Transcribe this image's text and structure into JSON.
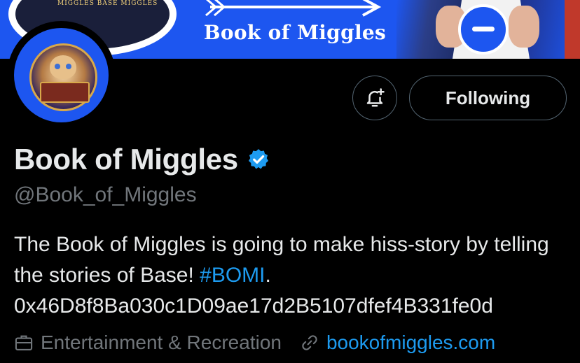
{
  "banner": {
    "title": "Book of Miggles",
    "book_text": "MIGGLES BASE MIGGLES",
    "colors": {
      "background": "#1d56f0",
      "accent": "#ffffff"
    }
  },
  "avatar": {
    "description_icon": "cat-avatar-icon"
  },
  "actions": {
    "notify_icon": "bell-plus-icon",
    "following_label": "Following"
  },
  "profile": {
    "display_name": "Book of Miggles",
    "verified_icon": "verified-badge-icon",
    "handle": "@Book_of_Miggles",
    "bio_prefix": "The Book of Miggles is going to make hiss-story by telling the stories of Base! ",
    "bio_hashtag": "#BOMI",
    "bio_suffix": ".",
    "bio_address": "0x46D8f8Ba030c1D09ae17d2B5107dfef4B331fe0d",
    "category_icon": "briefcase-icon",
    "category": "Entertainment & Recreation",
    "link_icon": "link-icon",
    "website": "bookofmiggles.com"
  },
  "colors": {
    "page_background": "#000000",
    "primary_text": "#e7e9ea",
    "secondary_text": "#71767b",
    "link": "#1d9bf0",
    "verified": "#1d9bf0",
    "button_border": "#536471"
  }
}
